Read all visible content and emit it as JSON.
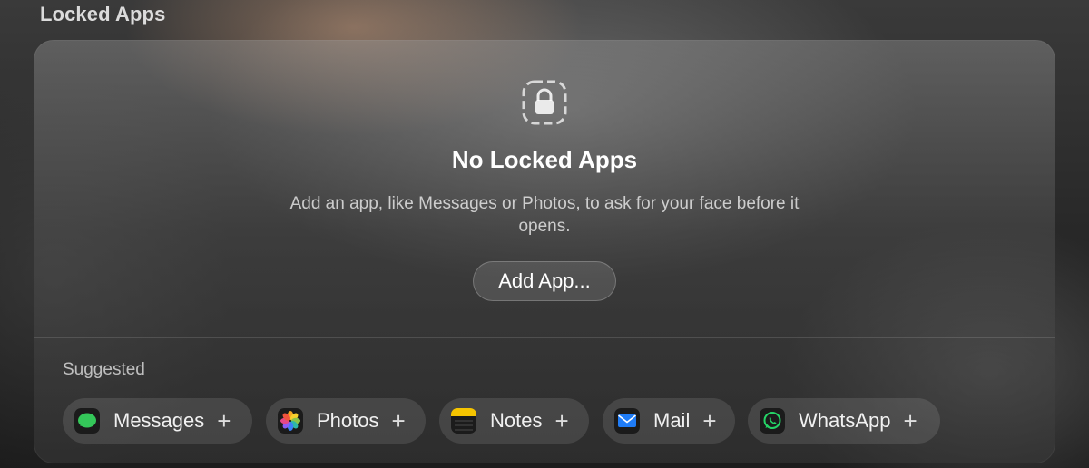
{
  "section": {
    "title": "Locked Apps"
  },
  "empty_state": {
    "icon": "lock-dashed-icon",
    "title": "No Locked Apps",
    "description": "Add an app, like Messages or Photos, to ask for your face before it opens.",
    "button_label": "Add App..."
  },
  "suggested": {
    "label": "Suggested",
    "apps": [
      {
        "name": "Messages",
        "icon": "messages-icon",
        "action": "+"
      },
      {
        "name": "Photos",
        "icon": "photos-icon",
        "action": "+"
      },
      {
        "name": "Notes",
        "icon": "notes-icon",
        "action": "+"
      },
      {
        "name": "Mail",
        "icon": "mail-icon",
        "action": "+"
      },
      {
        "name": "WhatsApp",
        "icon": "whatsapp-icon",
        "action": "+"
      }
    ]
  },
  "colors": {
    "messages_green": "#34c759",
    "notes_yellow": "#f5c400",
    "mail_blue": "#1f7cf6",
    "whatsapp_green": "#25d366"
  }
}
